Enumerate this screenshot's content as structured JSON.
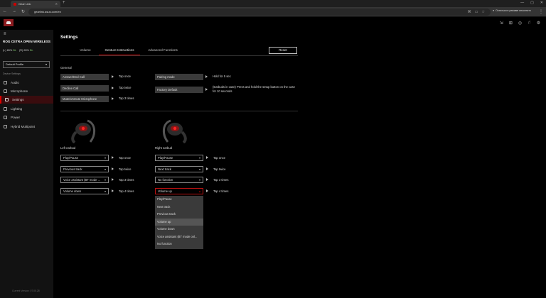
{
  "browser": {
    "tab_title": "Gear Link",
    "new_tab": "+",
    "url": "gearlink.asus.com/en",
    "incognito_label": "Остаться в режиме инкогнито"
  },
  "sidebar": {
    "device_name_prefix": "ROG",
    "device_name": "ROG CETRA OPEN WIRELESS",
    "battery_left_label": "(L) 65%",
    "battery_left_value": "BL",
    "battery_right_label": "(R) 65%",
    "battery_right_value": "BL",
    "profile": "Default Profile",
    "section_label": "Device Settings",
    "items": [
      {
        "label": "Audio",
        "icon": "audio-icon"
      },
      {
        "label": "Microphone",
        "icon": "microphone-icon"
      },
      {
        "label": "Settings",
        "icon": "settings-icon",
        "active": true
      },
      {
        "label": "Lighting",
        "icon": "lighting-icon"
      },
      {
        "label": "Power",
        "icon": "power-icon"
      },
      {
        "label": "Hybrid Multipoint",
        "icon": "multipoint-icon"
      }
    ],
    "firmware": "Current Version: 07.00.28"
  },
  "main": {
    "title": "Settings",
    "tabs": [
      "Volume",
      "Gesture Instructions",
      "Advanced Functions"
    ],
    "active_tab": "Gesture Instructions",
    "reset_label": "Reset",
    "general_label": "General",
    "general": [
      {
        "action": "Answer/End Call",
        "gesture": "Tap once"
      },
      {
        "action": "Decline Call",
        "gesture": "Tap twice"
      },
      {
        "action": "Mute/Unmute Microphone",
        "gesture": "Tap 3 times"
      },
      {
        "action": "Pairing mode",
        "gesture": "Hold for 5 sec"
      },
      {
        "action": "Factory Default",
        "gesture": "(Earbuds in case) Press and hold the setup button on the case for 10 seconds"
      }
    ],
    "left": {
      "label": "Left earbud",
      "rows": [
        {
          "value": "Play/Pause",
          "gesture": "Tap once"
        },
        {
          "value": "Previous track",
          "gesture": "Tap twice"
        },
        {
          "value": "Voice assistant (BT mode ...",
          "gesture": "Tap 3 times"
        },
        {
          "value": "Volume down",
          "gesture": "Tap 4 times"
        }
      ]
    },
    "right": {
      "label": "Right earbud",
      "rows": [
        {
          "value": "Play/Pause",
          "gesture": "Tap once"
        },
        {
          "value": "Next track",
          "gesture": "Tap twice"
        },
        {
          "value": "No function",
          "gesture": "Tap 3 times"
        },
        {
          "value": "Volume up",
          "gesture": "Tap 4 times"
        }
      ]
    },
    "dropdown_options": [
      "Play/Pause",
      "Next track",
      "Previous track",
      "Volume up",
      "Volume down",
      "Voice assistant (BT mode onl...",
      "No function"
    ],
    "dropdown_highlighted": "Volume up"
  },
  "colors": {
    "accent": "#d00000",
    "active_bg": "#3a0c0e",
    "button_bg": "#3a3a3a"
  }
}
